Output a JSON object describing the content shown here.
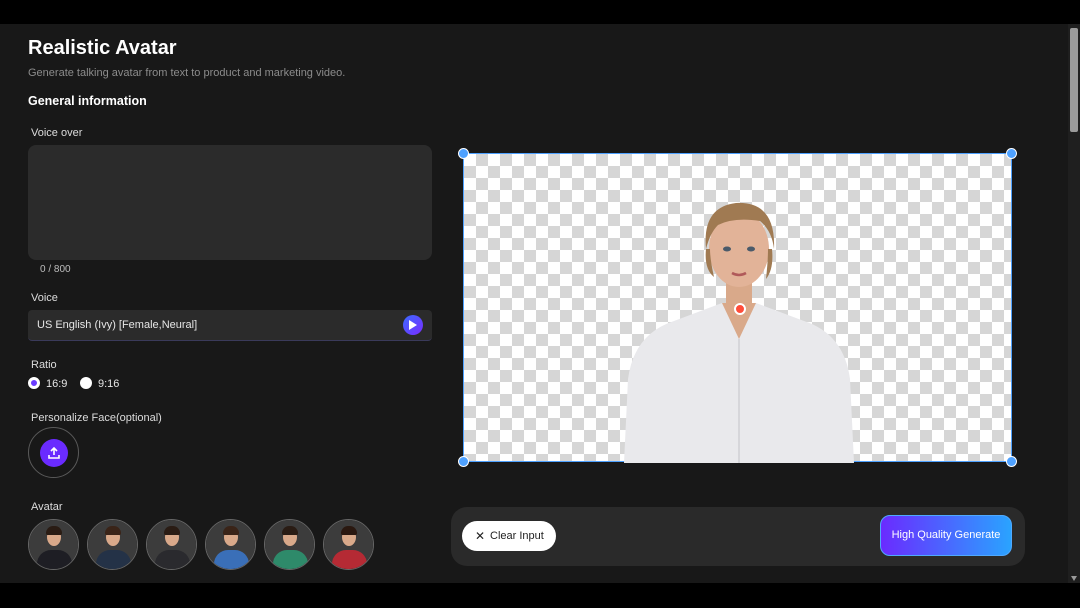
{
  "header": {
    "title": "Realistic Avatar",
    "subtitle": "Generate talking avatar from text to product and marketing video."
  },
  "general_section": "General information",
  "voice_over": {
    "label": "Voice over",
    "value": "",
    "counter": "0 / 800"
  },
  "voice": {
    "label": "Voice",
    "selected": "US English (Ivy) [Female,Neural]",
    "play_icon": "play-icon"
  },
  "ratio": {
    "label": "Ratio",
    "options": [
      {
        "label": "16:9",
        "selected": true
      },
      {
        "label": "9:16",
        "selected": false
      }
    ]
  },
  "personalize": {
    "label": "Personalize Face(optional)",
    "icon": "upload-icon"
  },
  "avatars": {
    "label": "Avatar",
    "items": [
      {
        "name": "avatar-man-dark-suit"
      },
      {
        "name": "avatar-man-blue-suit"
      },
      {
        "name": "avatar-man-tie"
      },
      {
        "name": "avatar-woman-blue"
      },
      {
        "name": "avatar-woman-green"
      },
      {
        "name": "avatar-woman-red"
      }
    ]
  },
  "actions": {
    "clear_label": "Clear Input",
    "generate_label": "High Quality Generate"
  },
  "colors": {
    "accent": "#6a2bff",
    "accent_blue": "#2aa3ff",
    "selection": "#4ea1ff",
    "background": "#181818",
    "panel": "#2b2b2b"
  }
}
